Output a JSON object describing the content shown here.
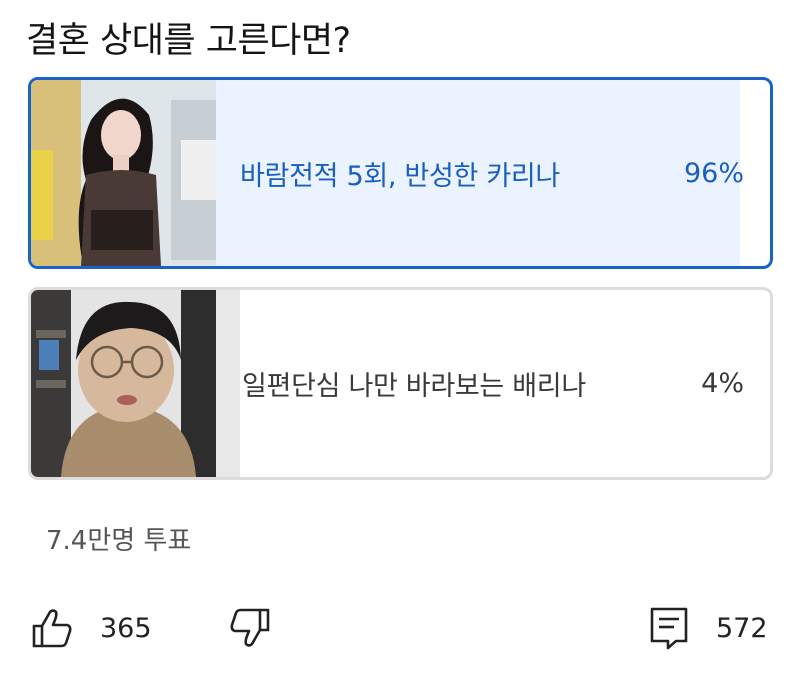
{
  "poll": {
    "question": "결혼 상대를 고른다면?",
    "options": [
      {
        "label": "바람전적 5회, 반성한 카리나",
        "percent": "96%",
        "fraction": 0.96,
        "selected": true
      },
      {
        "label": "일편단심 나만 바라보는 배리나",
        "percent": "4%",
        "fraction": 0.04,
        "selected": false
      }
    ],
    "vote_count": "7.4만명 투표"
  },
  "actions": {
    "like_count": "365",
    "comment_count": "572"
  },
  "colors": {
    "accent": "#1a63c6",
    "selected_fill": "#eaf3ff",
    "unselected_border": "#dcdcdc"
  }
}
